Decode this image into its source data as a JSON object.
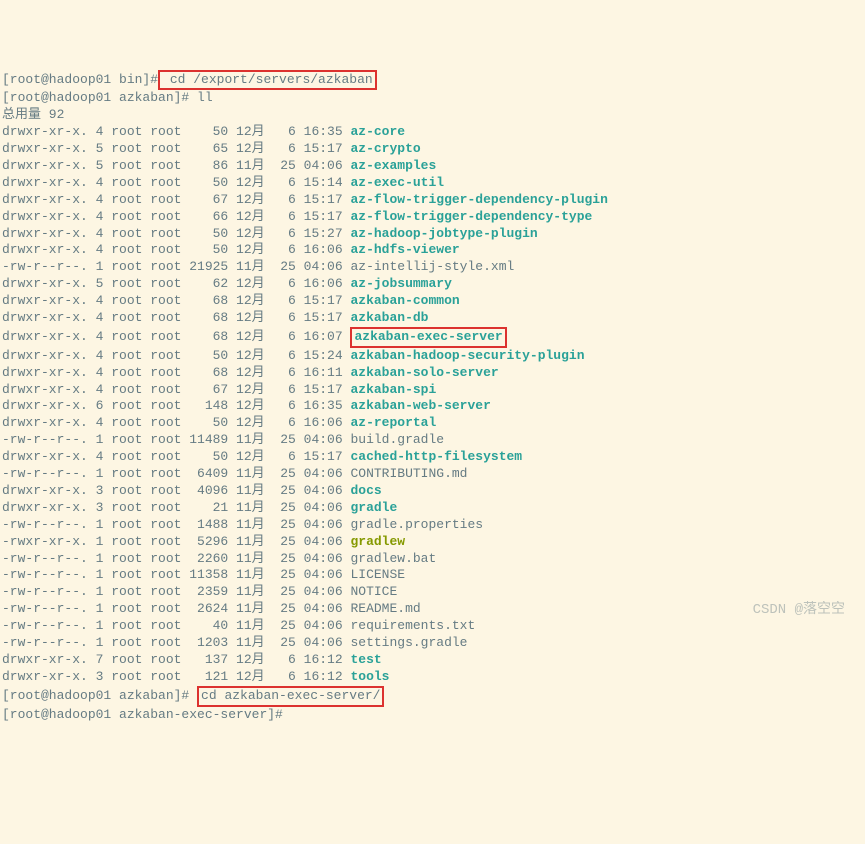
{
  "prompts": {
    "p1_user": "[root@hadoop01 bin]#",
    "p1_cmd": " cd /export/servers/azkaban",
    "p2_user": "[root@hadoop01 azkaban]#",
    "p2_cmd": " ll",
    "total": "总用量 92",
    "p3_user": "[root@hadoop01 azkaban]#",
    "p3_cmd": "cd azkaban-exec-server/",
    "p4_user": "[root@hadoop01 azkaban-exec-server]#"
  },
  "entries": [
    {
      "perm": "drwxr-xr-x.",
      "links": "4",
      "owner": "root",
      "group": "root",
      "size": "50",
      "month": "12月",
      "day": "6",
      "time": "16:35",
      "name": "az-core",
      "type": "dir"
    },
    {
      "perm": "drwxr-xr-x.",
      "links": "5",
      "owner": "root",
      "group": "root",
      "size": "65",
      "month": "12月",
      "day": "6",
      "time": "15:17",
      "name": "az-crypto",
      "type": "dir"
    },
    {
      "perm": "drwxr-xr-x.",
      "links": "5",
      "owner": "root",
      "group": "root",
      "size": "86",
      "month": "11月",
      "day": "25",
      "time": "04:06",
      "name": "az-examples",
      "type": "dir"
    },
    {
      "perm": "drwxr-xr-x.",
      "links": "4",
      "owner": "root",
      "group": "root",
      "size": "50",
      "month": "12月",
      "day": "6",
      "time": "15:14",
      "name": "az-exec-util",
      "type": "dir"
    },
    {
      "perm": "drwxr-xr-x.",
      "links": "4",
      "owner": "root",
      "group": "root",
      "size": "67",
      "month": "12月",
      "day": "6",
      "time": "15:17",
      "name": "az-flow-trigger-dependency-plugin",
      "type": "dir"
    },
    {
      "perm": "drwxr-xr-x.",
      "links": "4",
      "owner": "root",
      "group": "root",
      "size": "66",
      "month": "12月",
      "day": "6",
      "time": "15:17",
      "name": "az-flow-trigger-dependency-type",
      "type": "dir"
    },
    {
      "perm": "drwxr-xr-x.",
      "links": "4",
      "owner": "root",
      "group": "root",
      "size": "50",
      "month": "12月",
      "day": "6",
      "time": "15:27",
      "name": "az-hadoop-jobtype-plugin",
      "type": "dir"
    },
    {
      "perm": "drwxr-xr-x.",
      "links": "4",
      "owner": "root",
      "group": "root",
      "size": "50",
      "month": "12月",
      "day": "6",
      "time": "16:06",
      "name": "az-hdfs-viewer",
      "type": "dir"
    },
    {
      "perm": "-rw-r--r--.",
      "links": "1",
      "owner": "root",
      "group": "root",
      "size": "21925",
      "month": "11月",
      "day": "25",
      "time": "04:06",
      "name": "az-intellij-style.xml",
      "type": "file"
    },
    {
      "perm": "drwxr-xr-x.",
      "links": "5",
      "owner": "root",
      "group": "root",
      "size": "62",
      "month": "12月",
      "day": "6",
      "time": "16:06",
      "name": "az-jobsummary",
      "type": "dir"
    },
    {
      "perm": "drwxr-xr-x.",
      "links": "4",
      "owner": "root",
      "group": "root",
      "size": "68",
      "month": "12月",
      "day": "6",
      "time": "15:17",
      "name": "azkaban-common",
      "type": "dir"
    },
    {
      "perm": "drwxr-xr-x.",
      "links": "4",
      "owner": "root",
      "group": "root",
      "size": "68",
      "month": "12月",
      "day": "6",
      "time": "15:17",
      "name": "azkaban-db",
      "type": "dir"
    },
    {
      "perm": "drwxr-xr-x.",
      "links": "4",
      "owner": "root",
      "group": "root",
      "size": "68",
      "month": "12月",
      "day": "6",
      "time": "16:07",
      "name": "azkaban-exec-server",
      "type": "dir",
      "highlight": true
    },
    {
      "perm": "drwxr-xr-x.",
      "links": "4",
      "owner": "root",
      "group": "root",
      "size": "50",
      "month": "12月",
      "day": "6",
      "time": "15:24",
      "name": "azkaban-hadoop-security-plugin",
      "type": "dir"
    },
    {
      "perm": "drwxr-xr-x.",
      "links": "4",
      "owner": "root",
      "group": "root",
      "size": "68",
      "month": "12月",
      "day": "6",
      "time": "16:11",
      "name": "azkaban-solo-server",
      "type": "dir"
    },
    {
      "perm": "drwxr-xr-x.",
      "links": "4",
      "owner": "root",
      "group": "root",
      "size": "67",
      "month": "12月",
      "day": "6",
      "time": "15:17",
      "name": "azkaban-spi",
      "type": "dir"
    },
    {
      "perm": "drwxr-xr-x.",
      "links": "6",
      "owner": "root",
      "group": "root",
      "size": "148",
      "month": "12月",
      "day": "6",
      "time": "16:35",
      "name": "azkaban-web-server",
      "type": "dir"
    },
    {
      "perm": "drwxr-xr-x.",
      "links": "4",
      "owner": "root",
      "group": "root",
      "size": "50",
      "month": "12月",
      "day": "6",
      "time": "16:06",
      "name": "az-reportal",
      "type": "dir"
    },
    {
      "perm": "-rw-r--r--.",
      "links": "1",
      "owner": "root",
      "group": "root",
      "size": "11489",
      "month": "11月",
      "day": "25",
      "time": "04:06",
      "name": "build.gradle",
      "type": "file"
    },
    {
      "perm": "drwxr-xr-x.",
      "links": "4",
      "owner": "root",
      "group": "root",
      "size": "50",
      "month": "12月",
      "day": "6",
      "time": "15:17",
      "name": "cached-http-filesystem",
      "type": "dir"
    },
    {
      "perm": "-rw-r--r--.",
      "links": "1",
      "owner": "root",
      "group": "root",
      "size": "6409",
      "month": "11月",
      "day": "25",
      "time": "04:06",
      "name": "CONTRIBUTING.md",
      "type": "file"
    },
    {
      "perm": "drwxr-xr-x.",
      "links": "3",
      "owner": "root",
      "group": "root",
      "size": "4096",
      "month": "11月",
      "day": "25",
      "time": "04:06",
      "name": "docs",
      "type": "dir"
    },
    {
      "perm": "drwxr-xr-x.",
      "links": "3",
      "owner": "root",
      "group": "root",
      "size": "21",
      "month": "11月",
      "day": "25",
      "time": "04:06",
      "name": "gradle",
      "type": "dir"
    },
    {
      "perm": "-rw-r--r--.",
      "links": "1",
      "owner": "root",
      "group": "root",
      "size": "1488",
      "month": "11月",
      "day": "25",
      "time": "04:06",
      "name": "gradle.properties",
      "type": "file"
    },
    {
      "perm": "-rwxr-xr-x.",
      "links": "1",
      "owner": "root",
      "group": "root",
      "size": "5296",
      "month": "11月",
      "day": "25",
      "time": "04:06",
      "name": "gradlew",
      "type": "exec"
    },
    {
      "perm": "-rw-r--r--.",
      "links": "1",
      "owner": "root",
      "group": "root",
      "size": "2260",
      "month": "11月",
      "day": "25",
      "time": "04:06",
      "name": "gradlew.bat",
      "type": "file"
    },
    {
      "perm": "-rw-r--r--.",
      "links": "1",
      "owner": "root",
      "group": "root",
      "size": "11358",
      "month": "11月",
      "day": "25",
      "time": "04:06",
      "name": "LICENSE",
      "type": "file"
    },
    {
      "perm": "-rw-r--r--.",
      "links": "1",
      "owner": "root",
      "group": "root",
      "size": "2359",
      "month": "11月",
      "day": "25",
      "time": "04:06",
      "name": "NOTICE",
      "type": "file"
    },
    {
      "perm": "-rw-r--r--.",
      "links": "1",
      "owner": "root",
      "group": "root",
      "size": "2624",
      "month": "11月",
      "day": "25",
      "time": "04:06",
      "name": "README.md",
      "type": "file"
    },
    {
      "perm": "-rw-r--r--.",
      "links": "1",
      "owner": "root",
      "group": "root",
      "size": "40",
      "month": "11月",
      "day": "25",
      "time": "04:06",
      "name": "requirements.txt",
      "type": "file"
    },
    {
      "perm": "-rw-r--r--.",
      "links": "1",
      "owner": "root",
      "group": "root",
      "size": "1203",
      "month": "11月",
      "day": "25",
      "time": "04:06",
      "name": "settings.gradle",
      "type": "file"
    },
    {
      "perm": "drwxr-xr-x.",
      "links": "7",
      "owner": "root",
      "group": "root",
      "size": "137",
      "month": "12月",
      "day": "6",
      "time": "16:12",
      "name": "test",
      "type": "dir"
    },
    {
      "perm": "drwxr-xr-x.",
      "links": "3",
      "owner": "root",
      "group": "root",
      "size": "121",
      "month": "12月",
      "day": "6",
      "time": "16:12",
      "name": "tools",
      "type": "dir"
    }
  ],
  "watermark": "CSDN @落空空"
}
